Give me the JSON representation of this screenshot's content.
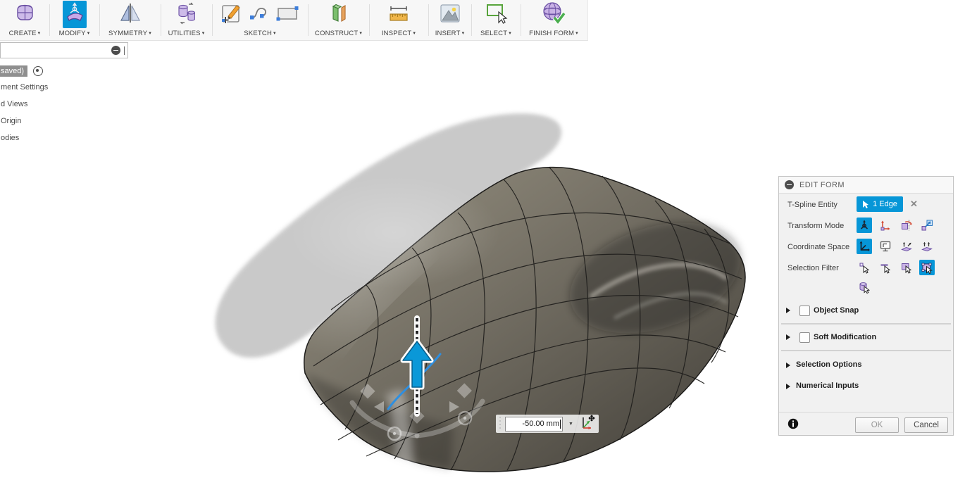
{
  "toolbar": {
    "caret": "▾",
    "groups": [
      {
        "label": "CREATE"
      },
      {
        "label": "MODIFY"
      },
      {
        "label": "SYMMETRY"
      },
      {
        "label": "UTILITIES"
      },
      {
        "label": "SKETCH"
      },
      {
        "label": "CONSTRUCT"
      },
      {
        "label": "INSPECT"
      },
      {
        "label": "INSERT"
      },
      {
        "label": "SELECT"
      },
      {
        "label": "FINISH FORM"
      }
    ]
  },
  "browser": {
    "items": [
      {
        "label": "saved)"
      },
      {
        "label": "ment Settings"
      },
      {
        "label": "d Views"
      },
      {
        "label": "Origin"
      },
      {
        "label": "odies"
      }
    ]
  },
  "dialog": {
    "title": "EDIT FORM",
    "close_x": "✕",
    "rows": {
      "entity_label": "T-Spline Entity",
      "entity_value": "1 Edge",
      "transform_label": "Transform Mode",
      "coordinate_label": "Coordinate Space",
      "filter_label": "Selection Filter"
    },
    "sections": {
      "object_snap": "Object Snap",
      "soft_modification": "Soft Modification",
      "selection_options": "Selection Options",
      "numerical_inputs": "Numerical Inputs"
    },
    "buttons": {
      "ok": "OK",
      "cancel": "Cancel"
    }
  },
  "manipulator": {
    "distance_value": "-50.00 mm",
    "dropdown_caret": "▼"
  },
  "colors": {
    "accent_blue": "#0696d7",
    "selected_edge_blue": "#2e8fe0",
    "body_base": "#6e695f",
    "silhouette_gray": "#c7c7c7"
  }
}
